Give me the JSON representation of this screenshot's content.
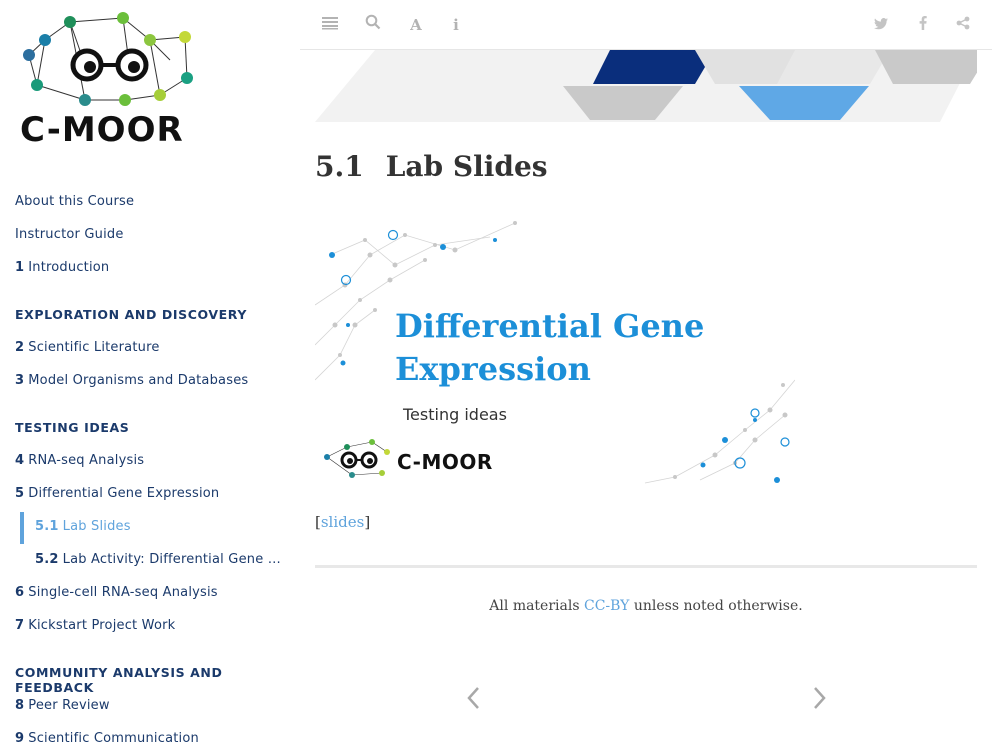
{
  "sidebar": {
    "logo_text": "C-MOOR",
    "items": [
      {
        "num": "",
        "label": "About this Course",
        "type": "item"
      },
      {
        "num": "",
        "label": "Instructor Guide",
        "type": "item"
      },
      {
        "num": "1",
        "label": "Introduction",
        "type": "item"
      },
      {
        "num": "",
        "label": "EXPLORATION AND DISCOVERY",
        "type": "section"
      },
      {
        "num": "2",
        "label": "Scientific Literature",
        "type": "item"
      },
      {
        "num": "3",
        "label": "Model Organisms and Databases",
        "type": "item"
      },
      {
        "num": "",
        "label": "TESTING IDEAS",
        "type": "section"
      },
      {
        "num": "4",
        "label": "RNA-seq Analysis",
        "type": "item"
      },
      {
        "num": "5",
        "label": "Differential Gene Expression",
        "type": "item"
      },
      {
        "num": "5.1",
        "label": "Lab Slides",
        "type": "sub-active"
      },
      {
        "num": "5.2",
        "label": "Lab Activity: Differential Gene Expression",
        "type": "sub"
      },
      {
        "num": "6",
        "label": "Single-cell RNA-seq Analysis",
        "type": "item"
      },
      {
        "num": "7",
        "label": "Kickstart Project Work",
        "type": "item"
      },
      {
        "num": "",
        "label": "COMMUNITY ANALYSIS AND FEEDBACK",
        "type": "section"
      },
      {
        "num": "8",
        "label": "Peer Review",
        "type": "item"
      },
      {
        "num": "9",
        "label": "Scientific Communication",
        "type": "item"
      }
    ]
  },
  "toolbar": {
    "icons": [
      "menu-icon",
      "search-icon",
      "font-icon",
      "info-icon",
      "twitter-icon",
      "facebook-icon",
      "share-icon"
    ]
  },
  "page": {
    "section_number": "5.1",
    "title": "Lab Slides"
  },
  "slide": {
    "title": "Differential Gene Expression",
    "subtitle": "Testing ideas",
    "brand": "C-MOOR"
  },
  "links": {
    "slides_label": "slides"
  },
  "footer": {
    "prefix": "All materials ",
    "license": "CC-BY",
    "suffix": " unless noted otherwise."
  },
  "colors": {
    "accent": "#5fa3dc",
    "nav_text": "#1b3a6b",
    "slide_title": "#1c8fd8",
    "banner_dark": "#0a2e7c",
    "banner_blue": "#5fa8e6",
    "banner_grey": "#c9c9c9"
  }
}
